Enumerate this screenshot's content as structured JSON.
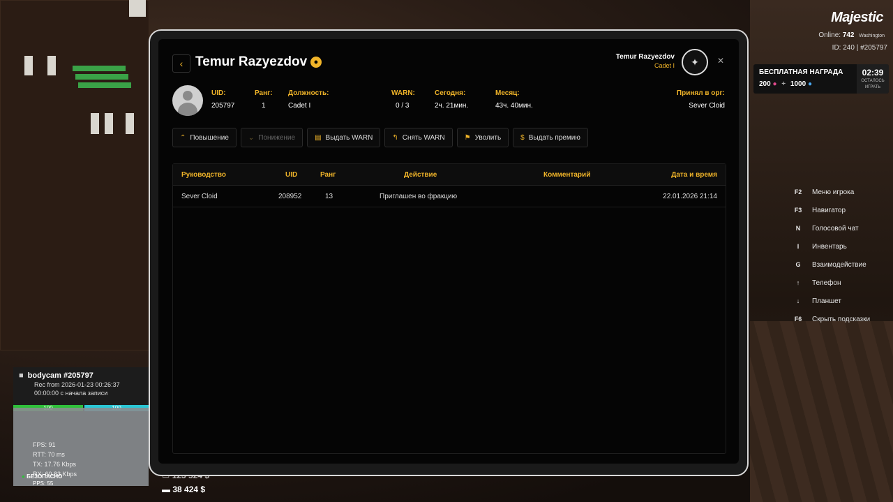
{
  "hud": {
    "brand": "Majestic",
    "online_label": "Online:",
    "online_count": "742",
    "city": "Washington",
    "id_line": "ID: 240 | #205797",
    "reward_title": "БЕСПЛАТНАЯ НАГРАДА",
    "reward_val1": "200",
    "reward_plus": "+",
    "reward_val2": "1000",
    "reward_time": "02:39",
    "reward_sub1": "ОСТАЛОСЬ",
    "reward_sub2": "ИГРАТЬ",
    "hints": [
      {
        "key": "F2",
        "label": "Меню игрока"
      },
      {
        "key": "F3",
        "label": "Навигатор"
      },
      {
        "key": "N",
        "label": "Голосовой чат"
      },
      {
        "key": "I",
        "label": "Инвентарь"
      },
      {
        "key": "G",
        "label": "Взаимодействие"
      },
      {
        "key": "↑",
        "label": "Телефон"
      },
      {
        "key": "↓",
        "label": "Планшет"
      },
      {
        "key": "F6",
        "label": "Скрыть подсказки"
      }
    ]
  },
  "bodycam": {
    "title": "bodycam #205797",
    "rec": "Rec from 2026-01-23 00:26:37",
    "elapsed": "00:00:00 с начала записи",
    "bar1": "100",
    "bar2": "100",
    "fps": "FPS:  91",
    "rtt": "RTT:  70 ms",
    "tx": "TX:   17.76 Kbps",
    "rx": "RX:   60.83 Kbps",
    "pps": "PPS:  55",
    "safe": "БЕЗОПАСНО"
  },
  "money": {
    "cash": "123 524 $",
    "bank": "38 424 $"
  },
  "profile": {
    "name": "Temur Razyezdov",
    "header_name": "Temur Razyezdov",
    "header_rank": "Cadet I",
    "uid_label": "UID:",
    "uid": "205797",
    "rank_label": "Ранг:",
    "rank": "1",
    "position_label": "Должность:",
    "position": "Cadet I",
    "warn_label": "WARN:",
    "warn": "0 / 3",
    "today_label": "Сегодня:",
    "today": "2ч. 21мин.",
    "month_label": "Месяц:",
    "month": "43ч. 40мин.",
    "accepted_label": "Принял в орг:",
    "accepted": "Sever Cloid"
  },
  "actions": [
    {
      "label": "Повышение",
      "icon": "chevron-up-icon",
      "glyph": "⌃",
      "enabled": true
    },
    {
      "label": "Понижение",
      "icon": "chevron-down-icon",
      "glyph": "⌄",
      "enabled": false
    },
    {
      "label": "Выдать WARN",
      "icon": "warn-doc-icon",
      "glyph": "▤",
      "enabled": true
    },
    {
      "label": "Снять WARN",
      "icon": "undo-icon",
      "glyph": "↰",
      "enabled": true
    },
    {
      "label": "Уволить",
      "icon": "fire-person-icon",
      "glyph": "⚑",
      "enabled": true
    },
    {
      "label": "Выдать премию",
      "icon": "coin-icon",
      "glyph": "$",
      "enabled": true
    }
  ],
  "table": {
    "headers": [
      "Руководство",
      "UID",
      "Ранг",
      "Действие",
      "Комментарий",
      "Дата и время"
    ],
    "rows": [
      [
        "Sever Cloid",
        "208952",
        "13",
        "Приглашен во фракцию",
        "",
        "22.01.2026 21:14"
      ]
    ]
  },
  "colors": {
    "accent": "#f0b429"
  }
}
